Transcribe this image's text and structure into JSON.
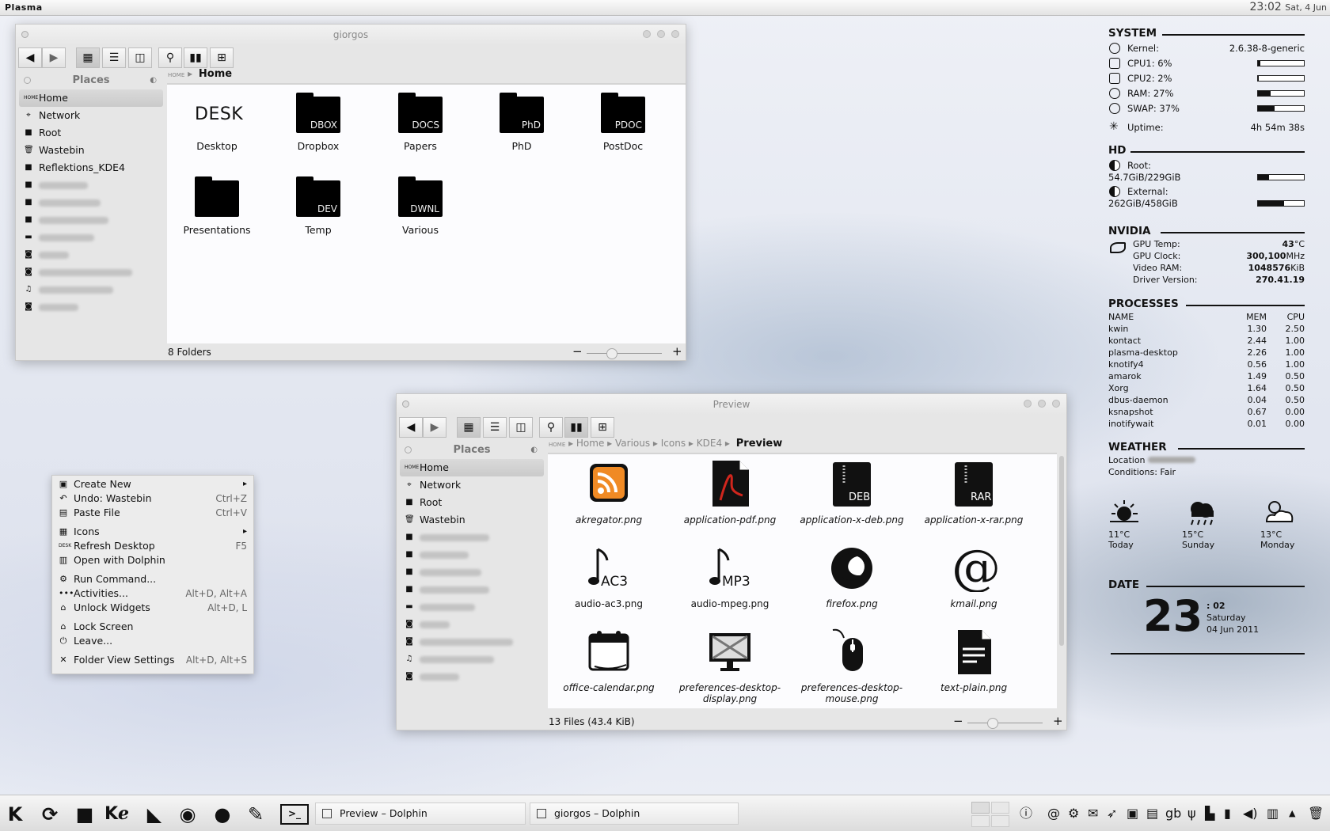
{
  "top_panel": {
    "name": "Plasma",
    "time": "23:02",
    "date": "Sat, 4 Jun"
  },
  "window1": {
    "title": "giorgos",
    "places_header": "Places",
    "places": [
      "Home",
      "Network",
      "Root",
      "Wastebin",
      "Reflektions_KDE4"
    ],
    "breadcrumb_home": "HOME",
    "breadcrumb_current": "Home",
    "items": [
      {
        "label": "Desktop",
        "tag": "DESK"
      },
      {
        "label": "Dropbox",
        "tag": "DBOX"
      },
      {
        "label": "Papers",
        "tag": "DOCS"
      },
      {
        "label": "PhD",
        "tag": "PhD"
      },
      {
        "label": "PostDoc",
        "tag": "PDOC"
      },
      {
        "label": "Presentations",
        "tag": ""
      },
      {
        "label": "Temp",
        "tag": "DEV"
      },
      {
        "label": "Various",
        "tag": "DWNL"
      }
    ],
    "status": "8 Folders"
  },
  "window2": {
    "title": "Preview",
    "places_header": "Places",
    "places": [
      "Home",
      "Network",
      "Root",
      "Wastebin"
    ],
    "breadcrumb": [
      "HOME",
      "Home",
      "Various",
      "Icons",
      "KDE4"
    ],
    "breadcrumb_current": "Preview",
    "files": [
      {
        "label": "akregator.png",
        "icon": "rss-icon"
      },
      {
        "label": "application-pdf.png",
        "icon": "pdf-icon"
      },
      {
        "label": "application-x-deb.png",
        "icon": "deb-icon"
      },
      {
        "label": "application-x-rar.png",
        "icon": "rar-icon"
      },
      {
        "label": "audio-ac3.png",
        "icon": "ac3-icon"
      },
      {
        "label": "audio-mpeg.png",
        "icon": "mp3-icon"
      },
      {
        "label": "firefox.png",
        "icon": "firefox-icon"
      },
      {
        "label": "kmail.png",
        "icon": "at-icon"
      },
      {
        "label": "office-calendar.png",
        "icon": "calendar-icon"
      },
      {
        "label": "preferences-desktop-display.png",
        "icon": "display-icon"
      },
      {
        "label": "preferences-desktop-mouse.png",
        "icon": "mouse-icon"
      },
      {
        "label": "text-plain.png",
        "icon": "text-icon"
      }
    ],
    "status": "13 Files (43.4 KiB)"
  },
  "context_menu": {
    "items": [
      {
        "label": "Create New",
        "shortcut": ""
      },
      {
        "label": "Undo: Wastebin",
        "shortcut": "Ctrl+Z"
      },
      {
        "label": "Paste File",
        "shortcut": "Ctrl+V"
      },
      {
        "label": "Icons",
        "shortcut": ""
      },
      {
        "label": "Refresh Desktop",
        "shortcut": "F5"
      },
      {
        "label": "Open with Dolphin",
        "shortcut": ""
      },
      {
        "label": "Run Command...",
        "shortcut": ""
      },
      {
        "label": "Activities...",
        "shortcut": "Alt+D, Alt+A"
      },
      {
        "label": "Unlock Widgets",
        "shortcut": "Alt+D, L"
      },
      {
        "label": "Lock Screen",
        "shortcut": ""
      },
      {
        "label": "Leave...",
        "shortcut": ""
      },
      {
        "label": "Folder View Settings",
        "shortcut": "Alt+D, Alt+S"
      }
    ]
  },
  "system": {
    "header": "SYSTEM",
    "kernel_label": "Kernel:",
    "kernel": "2.6.38-8-generic",
    "cpu1": "CPU1: 6%",
    "cpu1_level": 0.06,
    "cpu2": "CPU2: 2%",
    "cpu2_level": 0.02,
    "ram": "RAM: 27%",
    "ram_level": 0.27,
    "swap": "SWAP: 37%",
    "swap_level": 0.37,
    "uptime_label": "Uptime:",
    "uptime": "4h 54m 38s"
  },
  "hd": {
    "header": "HD",
    "root_label": "Root:",
    "root": "54.7GiB/229GiB",
    "root_level": 0.24,
    "external_label": "External:",
    "external": "262GiB/458GiB",
    "external_level": 0.57
  },
  "nvidia": {
    "header": "NVIDIA",
    "rows": [
      {
        "label": "GPU Temp:",
        "value": "43",
        "unit": "°C"
      },
      {
        "label": "GPU Clock:",
        "value": "300,100",
        "unit": "MHz"
      },
      {
        "label": "Video RAM:",
        "value": "1048576",
        "unit": "KiB"
      },
      {
        "label": "Driver Version:",
        "value": "270.41.19",
        "unit": ""
      }
    ]
  },
  "processes": {
    "header": "PROCESSES",
    "cols": {
      "name": "NAME",
      "mem": "MEM",
      "cpu": "CPU"
    },
    "rows": [
      {
        "name": "kwin",
        "mem": "1.30",
        "cpu": "2.50"
      },
      {
        "name": "kontact",
        "mem": "2.44",
        "cpu": "1.00"
      },
      {
        "name": "plasma-desktop",
        "mem": "2.26",
        "cpu": "1.00"
      },
      {
        "name": "knotify4",
        "mem": "0.56",
        "cpu": "1.00"
      },
      {
        "name": "amarok",
        "mem": "1.49",
        "cpu": "0.50"
      },
      {
        "name": "Xorg",
        "mem": "1.64",
        "cpu": "0.50"
      },
      {
        "name": "dbus-daemon",
        "mem": "0.04",
        "cpu": "0.50"
      },
      {
        "name": "ksnapshot",
        "mem": "0.67",
        "cpu": "0.00"
      },
      {
        "name": "inotifywait",
        "mem": "0.01",
        "cpu": "0.00"
      }
    ]
  },
  "weather": {
    "header": "WEATHER",
    "location_label": "Location",
    "conditions": "Conditions: Fair",
    "days": [
      {
        "temp": "11°C",
        "day": "Today",
        "icon": "sun-icon"
      },
      {
        "temp": "15°C",
        "day": "Sunday",
        "icon": "rain-icon"
      },
      {
        "temp": "13°C",
        "day": "Monday",
        "icon": "cloud-sun-icon"
      }
    ]
  },
  "date": {
    "header": "DATE",
    "day_num": "23",
    "minutes": ": 02",
    "weekday": "Saturday",
    "full_date": "04 Jun 2011"
  },
  "taskbar": {
    "tasks": [
      "Preview – Dolphin",
      "giorgos – Dolphin"
    ],
    "tray_lang": "gb"
  }
}
